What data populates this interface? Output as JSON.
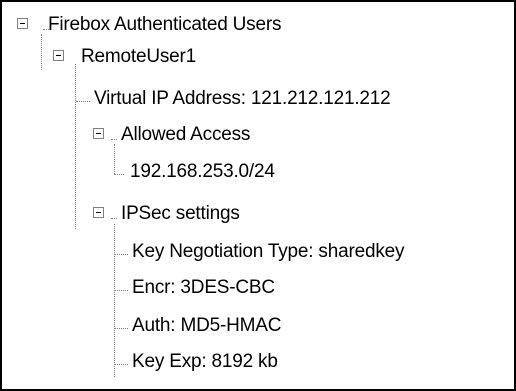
{
  "tree": {
    "root_label": "Firebox Authenticated Users",
    "user_label": "RemoteUser1",
    "virtual_ip_label": "Virtual IP Address: 121.212.121.212",
    "allowed_access_label": "Allowed Access",
    "subnet_label": "192.168.253.0/24",
    "ipsec_label": "IPSec settings",
    "key_negotiation_label": "Key Negotiation Type: sharedkey",
    "encr_label": "Encr: 3DES-CBC",
    "auth_label": "Auth: MD5-HMAC",
    "key_exp_label": "Key Exp: 8192 kb"
  }
}
